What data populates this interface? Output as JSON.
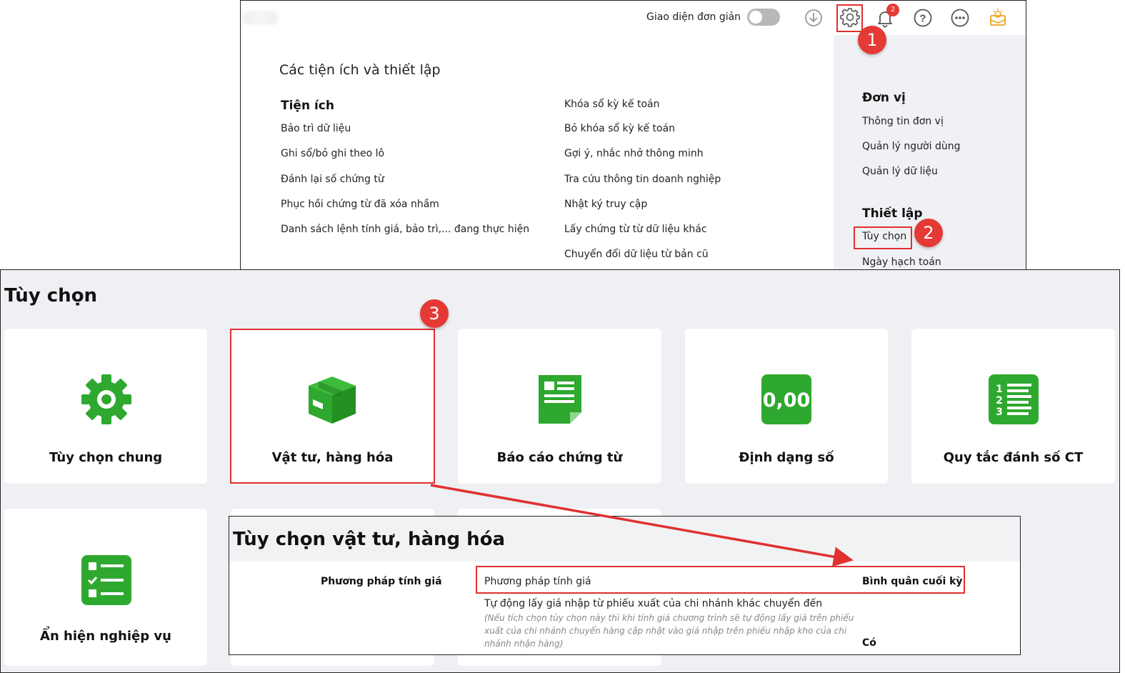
{
  "top_bar": {
    "simple_ui_label": "Giao diện đơn giản",
    "notification_count": "2"
  },
  "utilities": {
    "title": "Các tiện ích và thiết lập",
    "section_title": "Tiện ích",
    "col1": [
      "Bảo trì dữ liệu",
      "Ghi sổ/bỏ ghi theo lô",
      "Đánh lại số chứng từ",
      "Phục hồi chứng từ đã xóa nhầm",
      "Danh sách lệnh tính giá, bảo trì,... đang thực hiện"
    ],
    "col2": [
      "Khóa sổ kỳ kế toán",
      "Bỏ khóa sổ kỳ kế toán",
      "Gợi ý, nhắc nhở thông minh",
      "Tra cứu thông tin doanh nghiệp",
      "Nhật ký truy cập",
      "Lấy chứng từ từ dữ liệu khác",
      "Chuyển đổi dữ liệu từ bản cũ"
    ]
  },
  "right_panel": {
    "unit_title": "Đơn vị",
    "unit_items": [
      "Thông tin đơn vị",
      "Quản lý người dùng",
      "Quản lý dữ liệu"
    ],
    "setup_title": "Thiết lập",
    "setup_items": [
      "Tùy chọn",
      "Ngày hạch toán"
    ]
  },
  "options": {
    "title": "Tùy chọn",
    "cards": [
      {
        "label": "Tùy chọn chung",
        "icon": "gear-icon"
      },
      {
        "label": "Vật tư, hàng hóa",
        "icon": "box-icon"
      },
      {
        "label": "Báo cáo chứng từ",
        "icon": "document-icon"
      },
      {
        "label": "Định dạng số",
        "icon": "number-format-icon",
        "icon_text": "0,00"
      },
      {
        "label": "Quy tắc đánh số CT",
        "icon": "numbered-list-icon"
      },
      {
        "label": "Ẩn hiện nghiệp vụ",
        "icon": "checklist-icon"
      }
    ]
  },
  "detail": {
    "title": "Tùy chọn vật tư, hàng hóa",
    "section_label": "Phương pháp tính giá",
    "rows": [
      {
        "name": "Phương pháp tính giá",
        "value": "Bình quân cuối kỳ"
      },
      {
        "name": "Tự động lấy giá nhập từ phiếu xuất của chi nhánh khác chuyển đến",
        "note": "(Nếu tích chọn tùy chọn này thì khi tính giá chương trình sẽ tự động lấy giá trên phiếu xuất của chi nhánh chuyển hàng cập nhật vào giá nhập trên phiếu nhập kho của chi nhánh nhận hàng)",
        "value": "Có"
      }
    ]
  },
  "step_badges": [
    "1",
    "2",
    "3"
  ],
  "colors": {
    "accent_green": "#2ea82e",
    "highlight_red": "#e03030",
    "badge_red": "#e53935"
  }
}
